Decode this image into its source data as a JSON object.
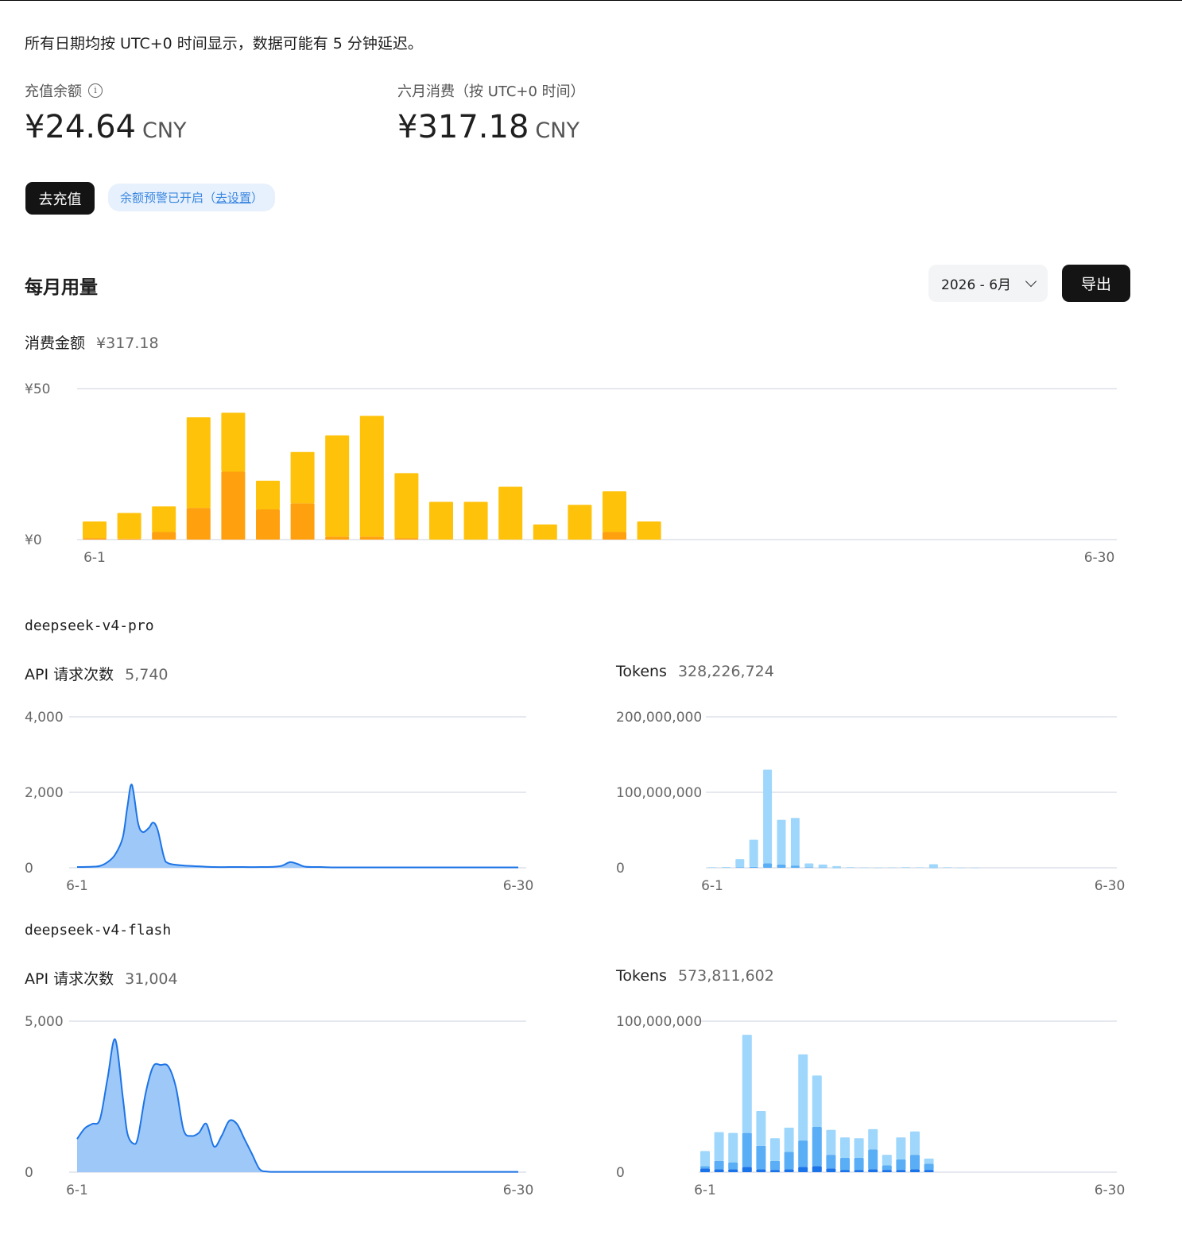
{
  "notice": "所有日期均按 UTC+0 时间显示，数据可能有 5 分钟延迟。",
  "balance": {
    "label": "充值余额",
    "value": "¥24.64",
    "unit": "CNY"
  },
  "monthly": {
    "label": "六月消费（按 UTC+0 时间）",
    "value": "¥317.18",
    "unit": "CNY"
  },
  "actions": {
    "topup": "去充值",
    "alert_text": "余额预警已开启（",
    "alert_link": "去设置",
    "alert_close": "）"
  },
  "usage": {
    "title": "每月用量",
    "month": "2026 - 6月",
    "export": "导出"
  },
  "cost": {
    "label": "消费金额",
    "value": "¥317.18"
  },
  "models": [
    {
      "name": "deepseek-v4-pro",
      "requests": {
        "label": "API 请求次数",
        "value": "5,740"
      },
      "tokens": {
        "label": "Tokens",
        "value": "328,226,724"
      }
    },
    {
      "name": "deepseek-v4-flash",
      "requests": {
        "label": "API 请求次数",
        "value": "31,004"
      },
      "tokens": {
        "label": "Tokens",
        "value": "573,811,602"
      }
    }
  ],
  "colors": {
    "cost_light": "#ffc20a",
    "cost_dark": "#ffa00f",
    "line": "#1d74e6",
    "area": "#9ec8f8",
    "tok_light": "#9ed7fb",
    "tok_mid": "#5aaef5",
    "tok_dark": "#1a73e8",
    "grid": "#dde1ea"
  },
  "chart_data": [
    {
      "id": "cost",
      "type": "bar",
      "stacked": true,
      "x_range": [
        "6-1",
        "6-30"
      ],
      "y_ticks": [
        "¥0",
        "¥50"
      ],
      "ylim": [
        0,
        50
      ],
      "series": [
        {
          "values": [
            0.5,
            0.3,
            2.5,
            10.5,
            22.5,
            10,
            12,
            1,
            1,
            0.5,
            0,
            0,
            0,
            0,
            0,
            2.5,
            0,
            0,
            0,
            0,
            0,
            0,
            0,
            0,
            0,
            0,
            0,
            0,
            0,
            0
          ]
        },
        {
          "values": [
            5.5,
            8.5,
            8.5,
            30,
            19.5,
            9.5,
            17,
            33.5,
            40,
            21.5,
            12.5,
            12.5,
            17.5,
            5,
            11.5,
            13.5,
            6,
            0,
            0,
            0,
            0,
            0,
            0,
            0,
            0,
            0,
            0,
            0,
            0,
            0
          ]
        }
      ]
    },
    {
      "id": "pro-requests",
      "type": "area",
      "x_range": [
        "6-1",
        "6-30"
      ],
      "y_ticks": [
        "0",
        "2,000",
        "4,000"
      ],
      "ylim": [
        0,
        4000
      ],
      "x": [
        1,
        2,
        2.5,
        3,
        3.5,
        4,
        4.3,
        4.6,
        5,
        5.3,
        5.7,
        6,
        6.3,
        6.7,
        7,
        8,
        9,
        10,
        11,
        12,
        13,
        14,
        14.5,
        15,
        15.5,
        16,
        17,
        18,
        19,
        20,
        21,
        22,
        23,
        24,
        25,
        26,
        27,
        28,
        29,
        30
      ],
      "values": [
        20,
        30,
        50,
        150,
        350,
        800,
        1600,
        2200,
        1200,
        950,
        1050,
        1200,
        1000,
        300,
        120,
        60,
        40,
        20,
        20,
        20,
        20,
        30,
        60,
        150,
        100,
        30,
        20,
        10,
        10,
        10,
        10,
        10,
        10,
        10,
        10,
        10,
        10,
        10,
        10,
        10
      ]
    },
    {
      "id": "pro-tokens",
      "type": "bar",
      "stacked": true,
      "x_range": [
        "6-1",
        "6-30"
      ],
      "y_ticks": [
        "0",
        "100,000,000",
        "200,000,000"
      ],
      "ylim": [
        0,
        200000000
      ],
      "series": [
        {
          "values": [
            0,
            0,
            500000,
            1200000,
            6000000,
            4500000,
            3000000,
            800000,
            400000,
            200000,
            0,
            0,
            0,
            0,
            0,
            0,
            300000,
            0,
            0,
            0,
            0,
            0,
            0,
            0,
            0,
            0,
            0,
            0,
            0,
            0
          ]
        },
        {
          "values": [
            600000,
            1000000,
            11000000,
            36000000,
            124000000,
            59000000,
            63000000,
            5000000,
            4000000,
            2000000,
            800000,
            400000,
            300000,
            400000,
            800000,
            500000,
            4500000,
            600000,
            300000,
            200000,
            0,
            0,
            0,
            0,
            0,
            0,
            0,
            0,
            0,
            0
          ]
        }
      ]
    },
    {
      "id": "flash-requests",
      "type": "area",
      "x_range": [
        "6-1",
        "6-30"
      ],
      "y_ticks": [
        "0",
        "5,000"
      ],
      "ylim": [
        0,
        5000
      ],
      "x": [
        1,
        1.5,
        2,
        2.5,
        3,
        3.5,
        4,
        4.3,
        4.7,
        5,
        5.5,
        6,
        6.5,
        7,
        7.5,
        8,
        8.5,
        9,
        9.5,
        10,
        10.5,
        11,
        11.5,
        12,
        12.5,
        13,
        13.5,
        14,
        14.5,
        15,
        15.5,
        16,
        16.5,
        17,
        17.5,
        18,
        19,
        20,
        21,
        22,
        23,
        24,
        25,
        26,
        27,
        28,
        29,
        30
      ],
      "values": [
        1100,
        1450,
        1600,
        1750,
        3100,
        4400,
        2500,
        1300,
        950,
        1150,
        2600,
        3500,
        3550,
        3500,
        2800,
        1400,
        1200,
        1300,
        1600,
        850,
        1200,
        1700,
        1600,
        1100,
        600,
        100,
        20,
        10,
        10,
        10,
        10,
        10,
        10,
        10,
        10,
        10,
        10,
        10,
        10,
        10,
        10,
        10,
        10,
        10,
        10,
        10,
        10,
        10
      ]
    },
    {
      "id": "flash-tokens",
      "type": "bar",
      "stacked": true,
      "x_range": [
        "6-1",
        "6-30"
      ],
      "y_ticks": [
        "0",
        "100,000,000"
      ],
      "ylim": [
        0,
        100000000
      ],
      "series": [
        {
          "values": [
            2500000,
            2000000,
            2000000,
            3500000,
            2000000,
            1500000,
            2000000,
            3500000,
            4000000,
            2500000,
            1500000,
            1500000,
            2000000,
            1500000,
            1500000,
            2000000,
            1500000,
            0,
            0,
            0,
            0,
            0,
            0,
            0,
            0,
            0,
            0,
            0,
            0,
            0
          ]
        },
        {
          "values": [
            1500000,
            5500000,
            4500000,
            22500000,
            15500000,
            6000000,
            11500000,
            17500000,
            26000000,
            9000000,
            8000000,
            8000000,
            13000000,
            3000000,
            7000000,
            9500000,
            4000000,
            0,
            0,
            0,
            0,
            0,
            0,
            0,
            0,
            0,
            0,
            0,
            0,
            0
          ]
        },
        {
          "values": [
            10000000,
            19000000,
            19500000,
            65000000,
            23000000,
            15000000,
            16000000,
            57000000,
            34000000,
            16500000,
            13500000,
            13000000,
            13500000,
            7000000,
            14500000,
            15500000,
            3500000,
            0,
            0,
            0,
            0,
            0,
            0,
            0,
            0,
            0,
            0,
            0,
            0,
            0
          ]
        }
      ]
    }
  ]
}
